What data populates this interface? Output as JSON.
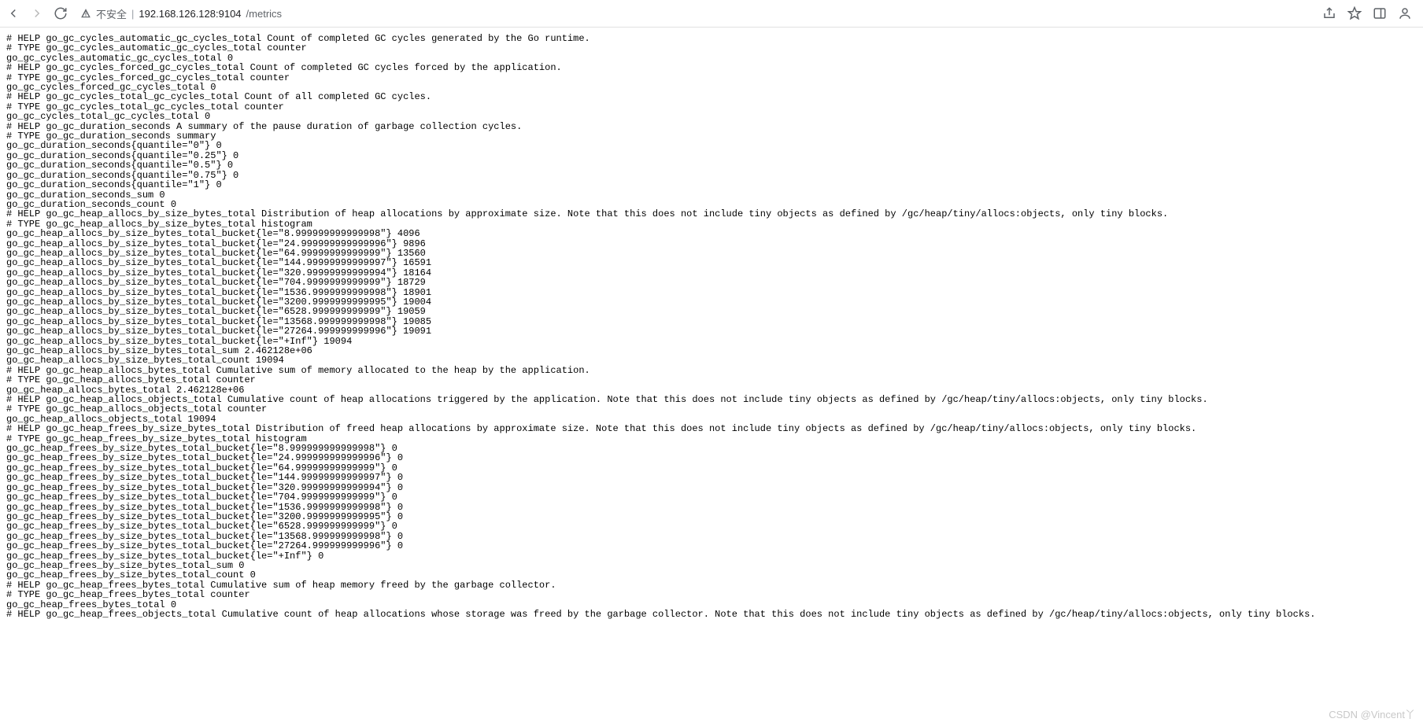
{
  "toolbar": {
    "insecure_label": "不安全",
    "url_host": "192.168.126.128:9104",
    "url_path": "/metrics"
  },
  "watermark": "CSDN @Vincent丫",
  "metrics_lines": [
    "# HELP go_gc_cycles_automatic_gc_cycles_total Count of completed GC cycles generated by the Go runtime.",
    "# TYPE go_gc_cycles_automatic_gc_cycles_total counter",
    "go_gc_cycles_automatic_gc_cycles_total 0",
    "# HELP go_gc_cycles_forced_gc_cycles_total Count of completed GC cycles forced by the application.",
    "# TYPE go_gc_cycles_forced_gc_cycles_total counter",
    "go_gc_cycles_forced_gc_cycles_total 0",
    "# HELP go_gc_cycles_total_gc_cycles_total Count of all completed GC cycles.",
    "# TYPE go_gc_cycles_total_gc_cycles_total counter",
    "go_gc_cycles_total_gc_cycles_total 0",
    "# HELP go_gc_duration_seconds A summary of the pause duration of garbage collection cycles.",
    "# TYPE go_gc_duration_seconds summary",
    "go_gc_duration_seconds{quantile=\"0\"} 0",
    "go_gc_duration_seconds{quantile=\"0.25\"} 0",
    "go_gc_duration_seconds{quantile=\"0.5\"} 0",
    "go_gc_duration_seconds{quantile=\"0.75\"} 0",
    "go_gc_duration_seconds{quantile=\"1\"} 0",
    "go_gc_duration_seconds_sum 0",
    "go_gc_duration_seconds_count 0",
    "# HELP go_gc_heap_allocs_by_size_bytes_total Distribution of heap allocations by approximate size. Note that this does not include tiny objects as defined by /gc/heap/tiny/allocs:objects, only tiny blocks.",
    "# TYPE go_gc_heap_allocs_by_size_bytes_total histogram",
    "go_gc_heap_allocs_by_size_bytes_total_bucket{le=\"8.999999999999998\"} 4096",
    "go_gc_heap_allocs_by_size_bytes_total_bucket{le=\"24.999999999999996\"} 9896",
    "go_gc_heap_allocs_by_size_bytes_total_bucket{le=\"64.99999999999999\"} 13560",
    "go_gc_heap_allocs_by_size_bytes_total_bucket{le=\"144.99999999999997\"} 16591",
    "go_gc_heap_allocs_by_size_bytes_total_bucket{le=\"320.99999999999994\"} 18164",
    "go_gc_heap_allocs_by_size_bytes_total_bucket{le=\"704.9999999999999\"} 18729",
    "go_gc_heap_allocs_by_size_bytes_total_bucket{le=\"1536.9999999999998\"} 18901",
    "go_gc_heap_allocs_by_size_bytes_total_bucket{le=\"3200.9999999999995\"} 19004",
    "go_gc_heap_allocs_by_size_bytes_total_bucket{le=\"6528.999999999999\"} 19059",
    "go_gc_heap_allocs_by_size_bytes_total_bucket{le=\"13568.999999999998\"} 19085",
    "go_gc_heap_allocs_by_size_bytes_total_bucket{le=\"27264.999999999996\"} 19091",
    "go_gc_heap_allocs_by_size_bytes_total_bucket{le=\"+Inf\"} 19094",
    "go_gc_heap_allocs_by_size_bytes_total_sum 2.462128e+06",
    "go_gc_heap_allocs_by_size_bytes_total_count 19094",
    "# HELP go_gc_heap_allocs_bytes_total Cumulative sum of memory allocated to the heap by the application.",
    "# TYPE go_gc_heap_allocs_bytes_total counter",
    "go_gc_heap_allocs_bytes_total 2.462128e+06",
    "# HELP go_gc_heap_allocs_objects_total Cumulative count of heap allocations triggered by the application. Note that this does not include tiny objects as defined by /gc/heap/tiny/allocs:objects, only tiny blocks.",
    "# TYPE go_gc_heap_allocs_objects_total counter",
    "go_gc_heap_allocs_objects_total 19094",
    "# HELP go_gc_heap_frees_by_size_bytes_total Distribution of freed heap allocations by approximate size. Note that this does not include tiny objects as defined by /gc/heap/tiny/allocs:objects, only tiny blocks.",
    "# TYPE go_gc_heap_frees_by_size_bytes_total histogram",
    "go_gc_heap_frees_by_size_bytes_total_bucket{le=\"8.999999999999998\"} 0",
    "go_gc_heap_frees_by_size_bytes_total_bucket{le=\"24.999999999999996\"} 0",
    "go_gc_heap_frees_by_size_bytes_total_bucket{le=\"64.99999999999999\"} 0",
    "go_gc_heap_frees_by_size_bytes_total_bucket{le=\"144.99999999999997\"} 0",
    "go_gc_heap_frees_by_size_bytes_total_bucket{le=\"320.99999999999994\"} 0",
    "go_gc_heap_frees_by_size_bytes_total_bucket{le=\"704.9999999999999\"} 0",
    "go_gc_heap_frees_by_size_bytes_total_bucket{le=\"1536.9999999999998\"} 0",
    "go_gc_heap_frees_by_size_bytes_total_bucket{le=\"3200.9999999999995\"} 0",
    "go_gc_heap_frees_by_size_bytes_total_bucket{le=\"6528.999999999999\"} 0",
    "go_gc_heap_frees_by_size_bytes_total_bucket{le=\"13568.999999999998\"} 0",
    "go_gc_heap_frees_by_size_bytes_total_bucket{le=\"27264.999999999996\"} 0",
    "go_gc_heap_frees_by_size_bytes_total_bucket{le=\"+Inf\"} 0",
    "go_gc_heap_frees_by_size_bytes_total_sum 0",
    "go_gc_heap_frees_by_size_bytes_total_count 0",
    "# HELP go_gc_heap_frees_bytes_total Cumulative sum of heap memory freed by the garbage collector.",
    "# TYPE go_gc_heap_frees_bytes_total counter",
    "go_gc_heap_frees_bytes_total 0",
    "# HELP go_gc_heap_frees_objects_total Cumulative count of heap allocations whose storage was freed by the garbage collector. Note that this does not include tiny objects as defined by /gc/heap/tiny/allocs:objects, only tiny blocks."
  ]
}
